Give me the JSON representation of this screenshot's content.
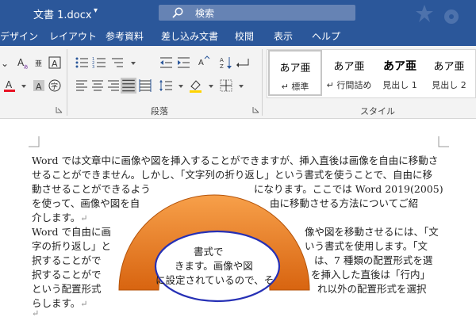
{
  "titlebar": {
    "doc_title": "文書 1.docx",
    "caret": "▾",
    "search_label": "検索",
    "search_icon": "search-icon",
    "color": "#2b579a"
  },
  "menu": {
    "tabs": [
      "デザイン",
      "レイアウト",
      "参考資料",
      "差し込み文書",
      "校閲",
      "表示",
      "ヘルプ"
    ]
  },
  "ribbon": {
    "font_buttons": [
      "phonetic-guide-icon",
      "character-border-icon",
      "clear-format-icon",
      "font-color-icon",
      "character-shading-icon",
      "enclose-characters-icon"
    ],
    "paragraph_label": "段落",
    "style_label": "スタイル",
    "font_color_accent": "#e81123"
  },
  "styles": [
    {
      "sample": "あア亜",
      "name": "↵ 標準",
      "selected": true
    },
    {
      "sample": "あア亜",
      "name": "↵ 行間詰め",
      "selected": false
    },
    {
      "sample": "あア亜",
      "name": "見出し 1",
      "selected": false
    },
    {
      "sample": "あア亜",
      "name": "見出し 2",
      "selected": false
    }
  ],
  "document": {
    "lines": [
      "Word では文章中に画像や図を挿入することができますが、挿入直後は画像を自由に移動さ",
      "せることができません。しかし、「文字列の折り返し」という書式を使うことで、自由に移",
      "動させることができるよう",
      "になります。ここでは Word 2019(2005)",
      "を使って、画像や図を自",
      "由に移動させる方法についてご紹",
      "介します。",
      "Word で自由に画",
      "像や図を移動させるには、「文",
      "字の折り返し」と",
      "いう書式を使用します。「文",
      "択することがで",
      "は、7 種類の配置形式を選",
      "択することがで",
      "を挿入した直後は「行内」",
      "という配置形式",
      "れ以外の配置形式を選択",
      "らします。",
      "書式で",
      "きます。画像や図",
      "に設定されているので、そ"
    ],
    "return_mark": "↵",
    "arch_color": "#f07f1e",
    "ellipse_color": "#2630b5"
  }
}
